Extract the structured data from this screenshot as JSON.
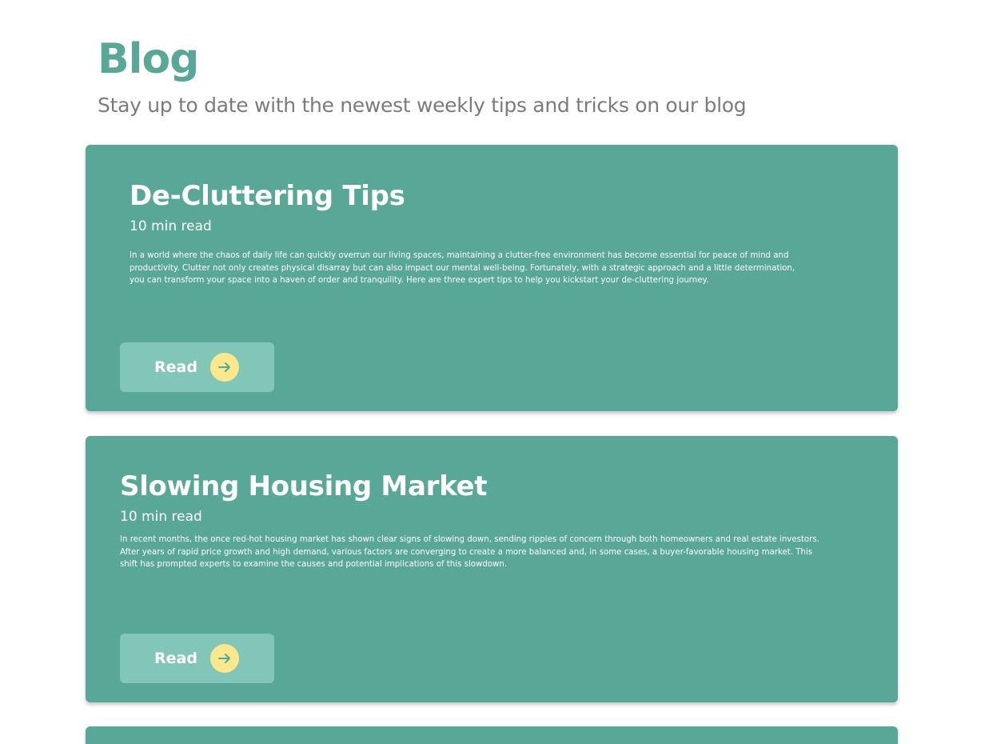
{
  "header": {
    "title": "Blog",
    "subtitle": "Stay up to date with the newest weekly tips and tricks on our blog"
  },
  "colors": {
    "accent": "#58a797",
    "card_bg": "#58a797",
    "button_bg": "#82c6b7",
    "arrow_circle": "#fbe88c",
    "arrow_stroke": "#58a797",
    "subtitle": "#7b7b7b"
  },
  "posts": [
    {
      "title": "De-Cluttering Tips",
      "read_time": "10 min read",
      "excerpt": "In a world where the chaos of daily life can quickly overrun our living spaces, maintaining a clutter-free environment has become essential for peace of mind and productivity. Clutter not only creates physical disarray but can also impact our mental well-being. Fortunately, with a strategic approach and a little determination, you can transform your space into a haven of order and tranquility. Here are three expert tips to help you kickstart your de-cluttering journey.",
      "button_label": "Read",
      "button_icon": "arrow-right-icon"
    },
    {
      "title": "Slowing Housing Market",
      "read_time": "10 min read",
      "excerpt": "In recent months, the once red-hot housing market has shown clear signs of slowing down, sending ripples of concern through both homeowners and real estate investors. After years of rapid price growth and high demand, various factors are converging to create a more balanced and, in some cases, a buyer-favorable housing market. This shift has prompted experts to examine the causes and potential implications of this slowdown.",
      "button_label": "Read",
      "button_icon": "arrow-right-icon"
    }
  ]
}
